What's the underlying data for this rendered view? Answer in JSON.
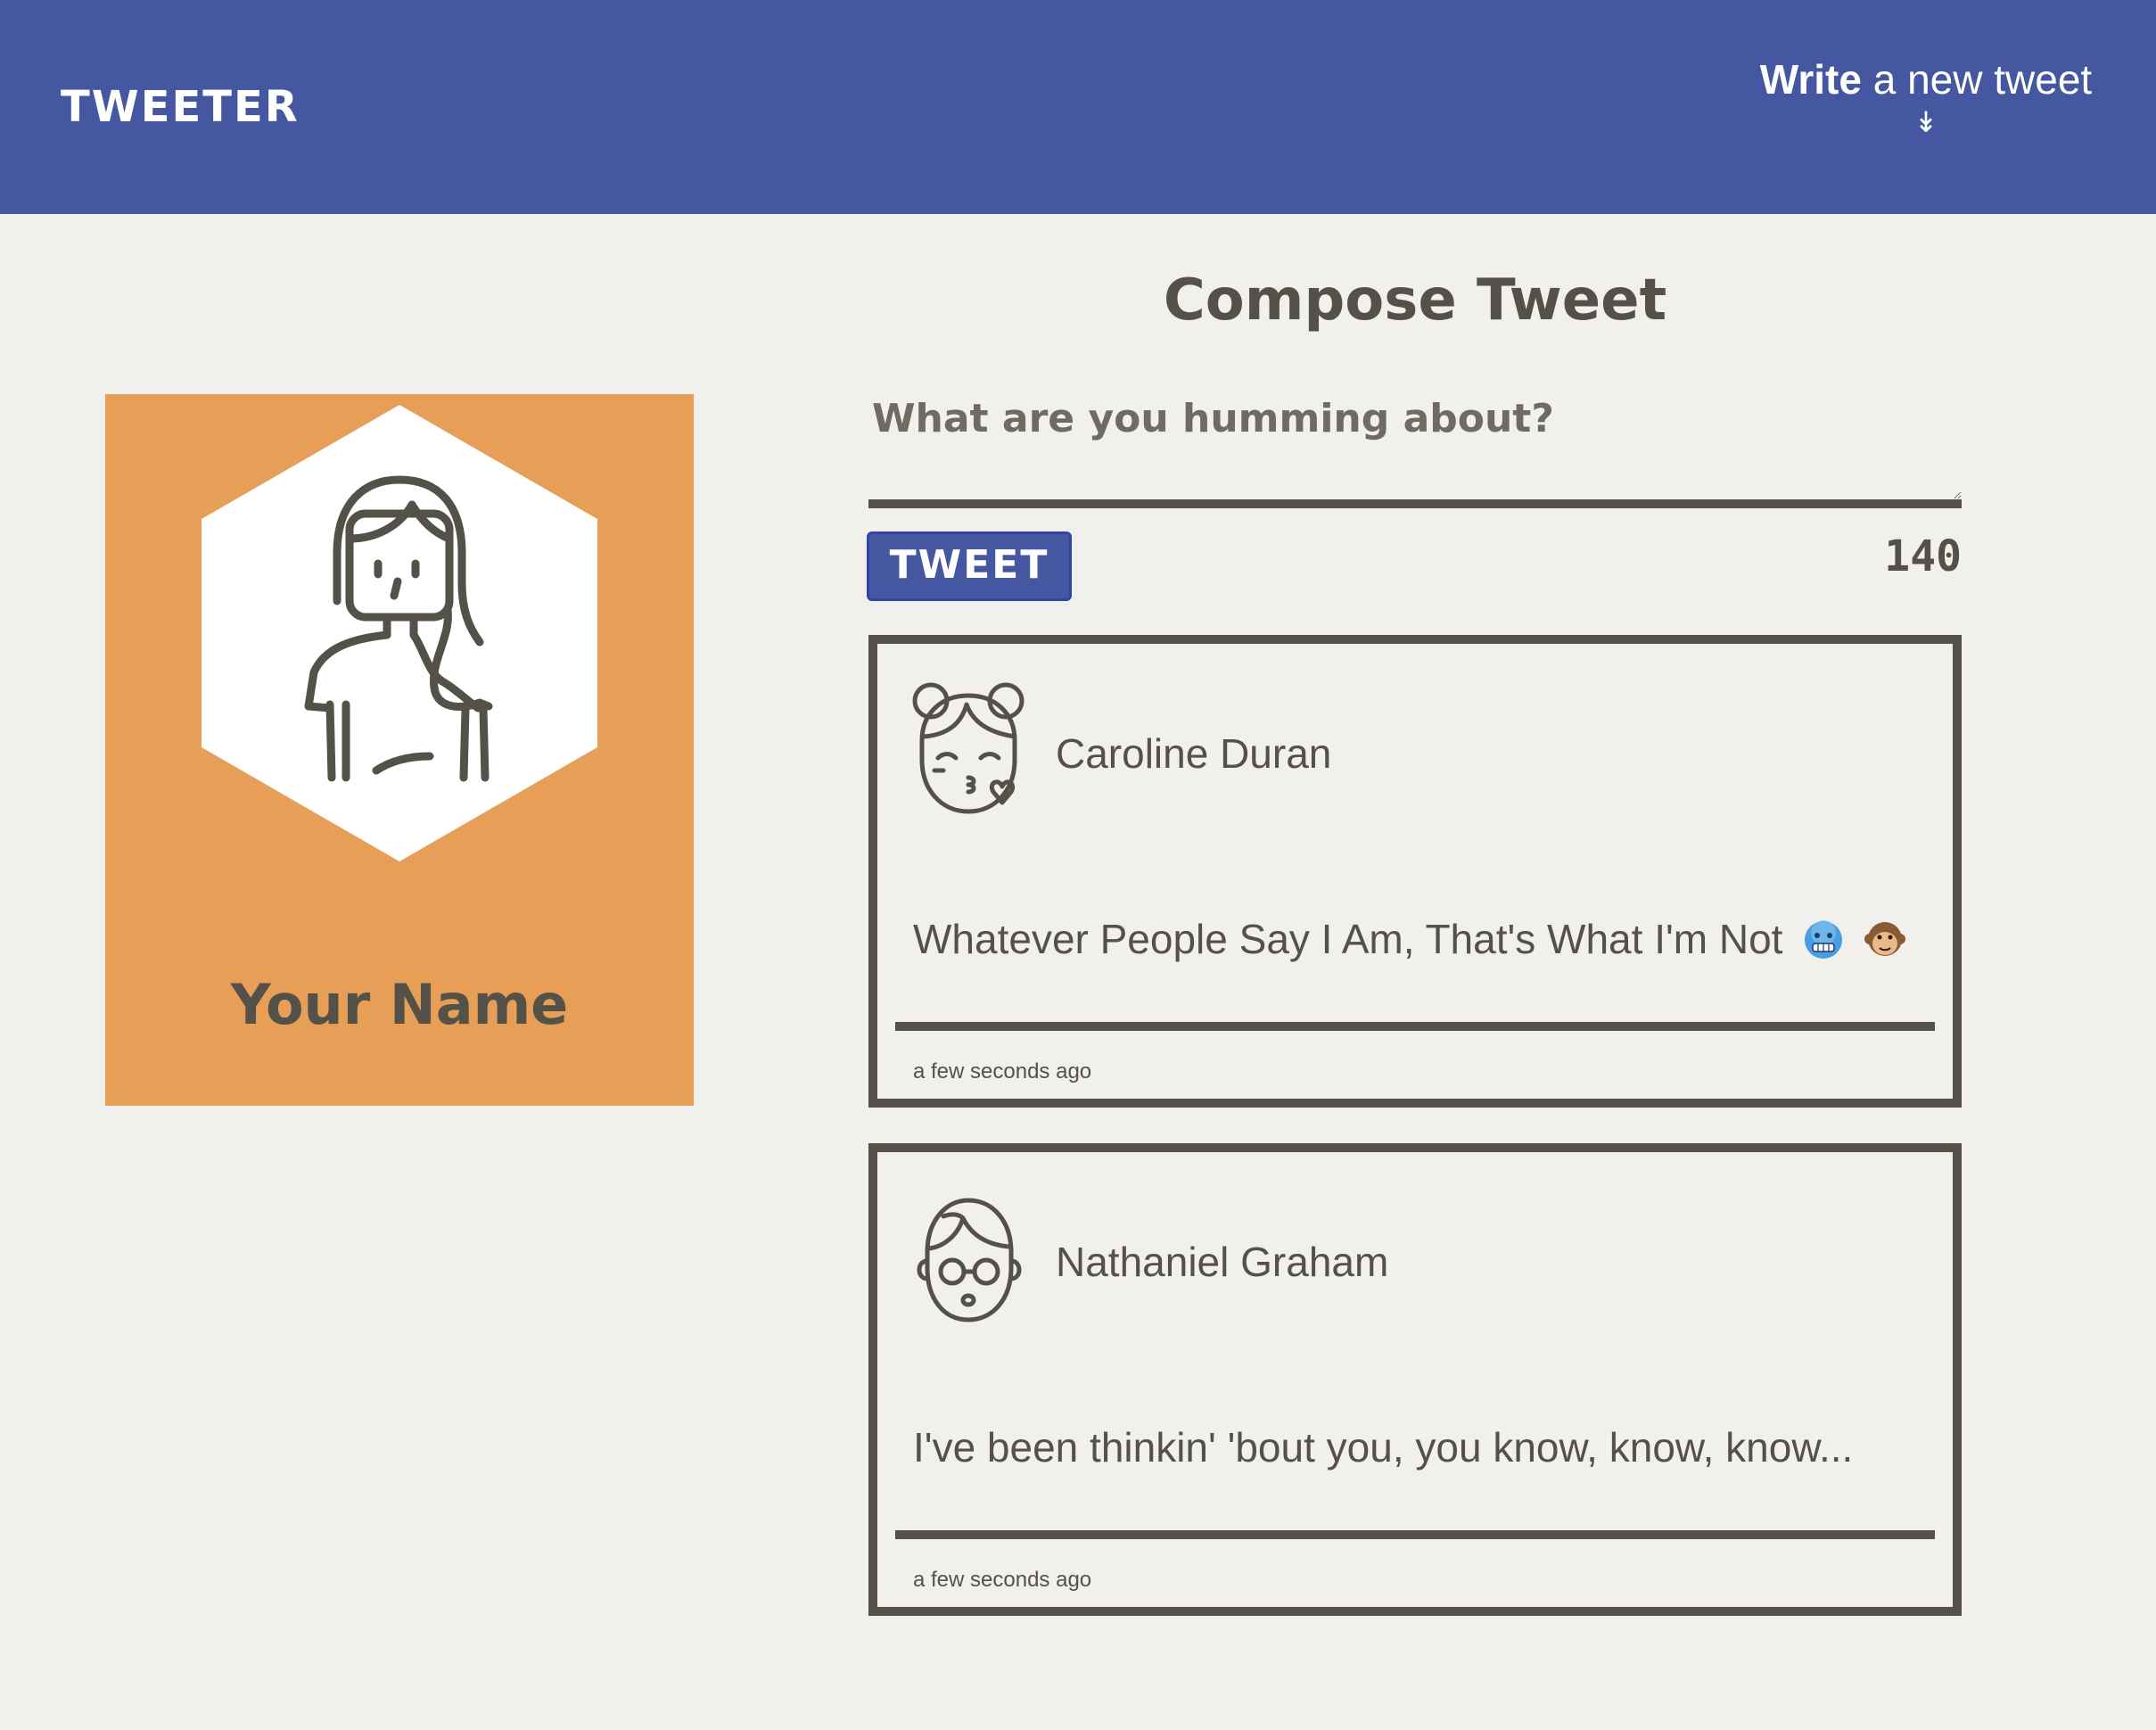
{
  "nav": {
    "brand": "TWEETER",
    "write_strong": "Write",
    "write_rest": " a new tweet",
    "write_arrow": "↡"
  },
  "profile": {
    "name": "Your Name",
    "avatar_icon": "woman-avatar-icon",
    "card_color": "#e79f58"
  },
  "compose": {
    "title": "Compose Tweet",
    "placeholder": "What are you humming about?",
    "button_label": "TWEET",
    "counter": "140"
  },
  "tweets": [
    {
      "author": "Caroline Duran",
      "avatar_icon": "girl-kiss-avatar-icon",
      "text": "Whatever People Say I Am, That's What I'm Not",
      "emojis": [
        "freezing-face-emoji",
        "monkey-face-emoji"
      ],
      "time": "a few seconds ago"
    },
    {
      "author": "Nathaniel Graham",
      "avatar_icon": "boy-glasses-avatar-icon",
      "text": "I've been thinkin' 'bout you, you know, know, know...",
      "emojis": [],
      "time": "a few seconds ago"
    }
  ],
  "colors": {
    "nav": "#4457a0",
    "background": "#f2f0ec",
    "text": "#545149",
    "accent_orange": "#e79f58"
  }
}
